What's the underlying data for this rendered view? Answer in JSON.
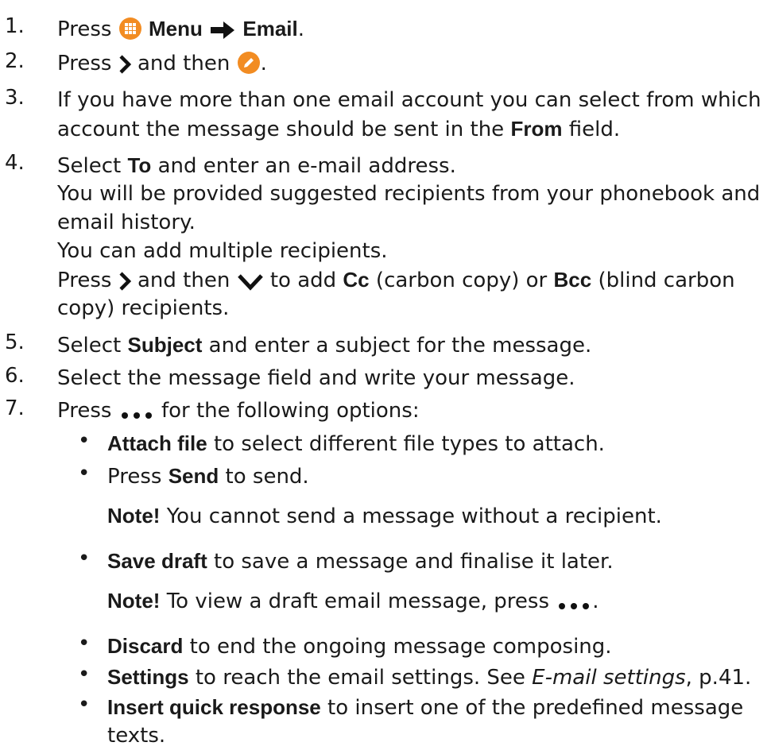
{
  "colors": {
    "text": "#1a1a1a",
    "accent_orange": "#f28c22"
  },
  "steps": [
    {
      "num": "1.",
      "p1": "Press ",
      "menu": "Menu",
      "email": "Email",
      "end": "."
    },
    {
      "num": "2.",
      "p1": "Press ",
      "p2": " and then ",
      "end": "."
    },
    {
      "num": "3.",
      "l1": "If you have more than one email account you can select from which",
      "l2a": "account the message should be sent in the ",
      "from": "From",
      "l2b": " field."
    },
    {
      "num": "4.",
      "p1": "Select ",
      "to": "To",
      "p2": " and enter an e-mail address.",
      "l2": "You will be provided suggested recipients from your phonebook and",
      "l3": "email history.",
      "l4": "You can add multiple recipients.",
      "l5a": "Press ",
      "l5b": " and then ",
      "l5c": " to add ",
      "cc": "Cc",
      "l5d": " (carbon copy) or ",
      "bcc": "Bcc",
      "l5e": " (blind carbon",
      "l6": "copy) recipients."
    },
    {
      "num": "5.",
      "p1": "Select ",
      "subject": "Subject",
      "p2": " and enter a subject for the message."
    },
    {
      "num": "6.",
      "p1": "Select the message field and write your message."
    },
    {
      "num": "7.",
      "p1": "Press ",
      "p2": " for the following options:"
    }
  ],
  "options": {
    "bullet": "•",
    "attach": {
      "b": "Attach file",
      "t": " to select different file types to attach."
    },
    "send": {
      "p": "Press ",
      "b": "Send",
      "t": " to send."
    },
    "note1": {
      "b": "Note!",
      "t": " You cannot send a message without a recipient."
    },
    "save": {
      "b": "Save draft",
      "t": " to save a message and finalise it later."
    },
    "note2": {
      "b": "Note!",
      "t": " To view a draft email message, press ",
      "end": "."
    },
    "discard": {
      "b": "Discard",
      "t": " to end the ongoing message composing."
    },
    "settings": {
      "b": "Settings",
      "t": " to reach the email settings. See ",
      "link": "E-mail settings",
      "end": ", p.41."
    },
    "quick": {
      "b": "Insert quick response",
      "t": " to insert one of the predefined message",
      "l2": "texts."
    }
  }
}
